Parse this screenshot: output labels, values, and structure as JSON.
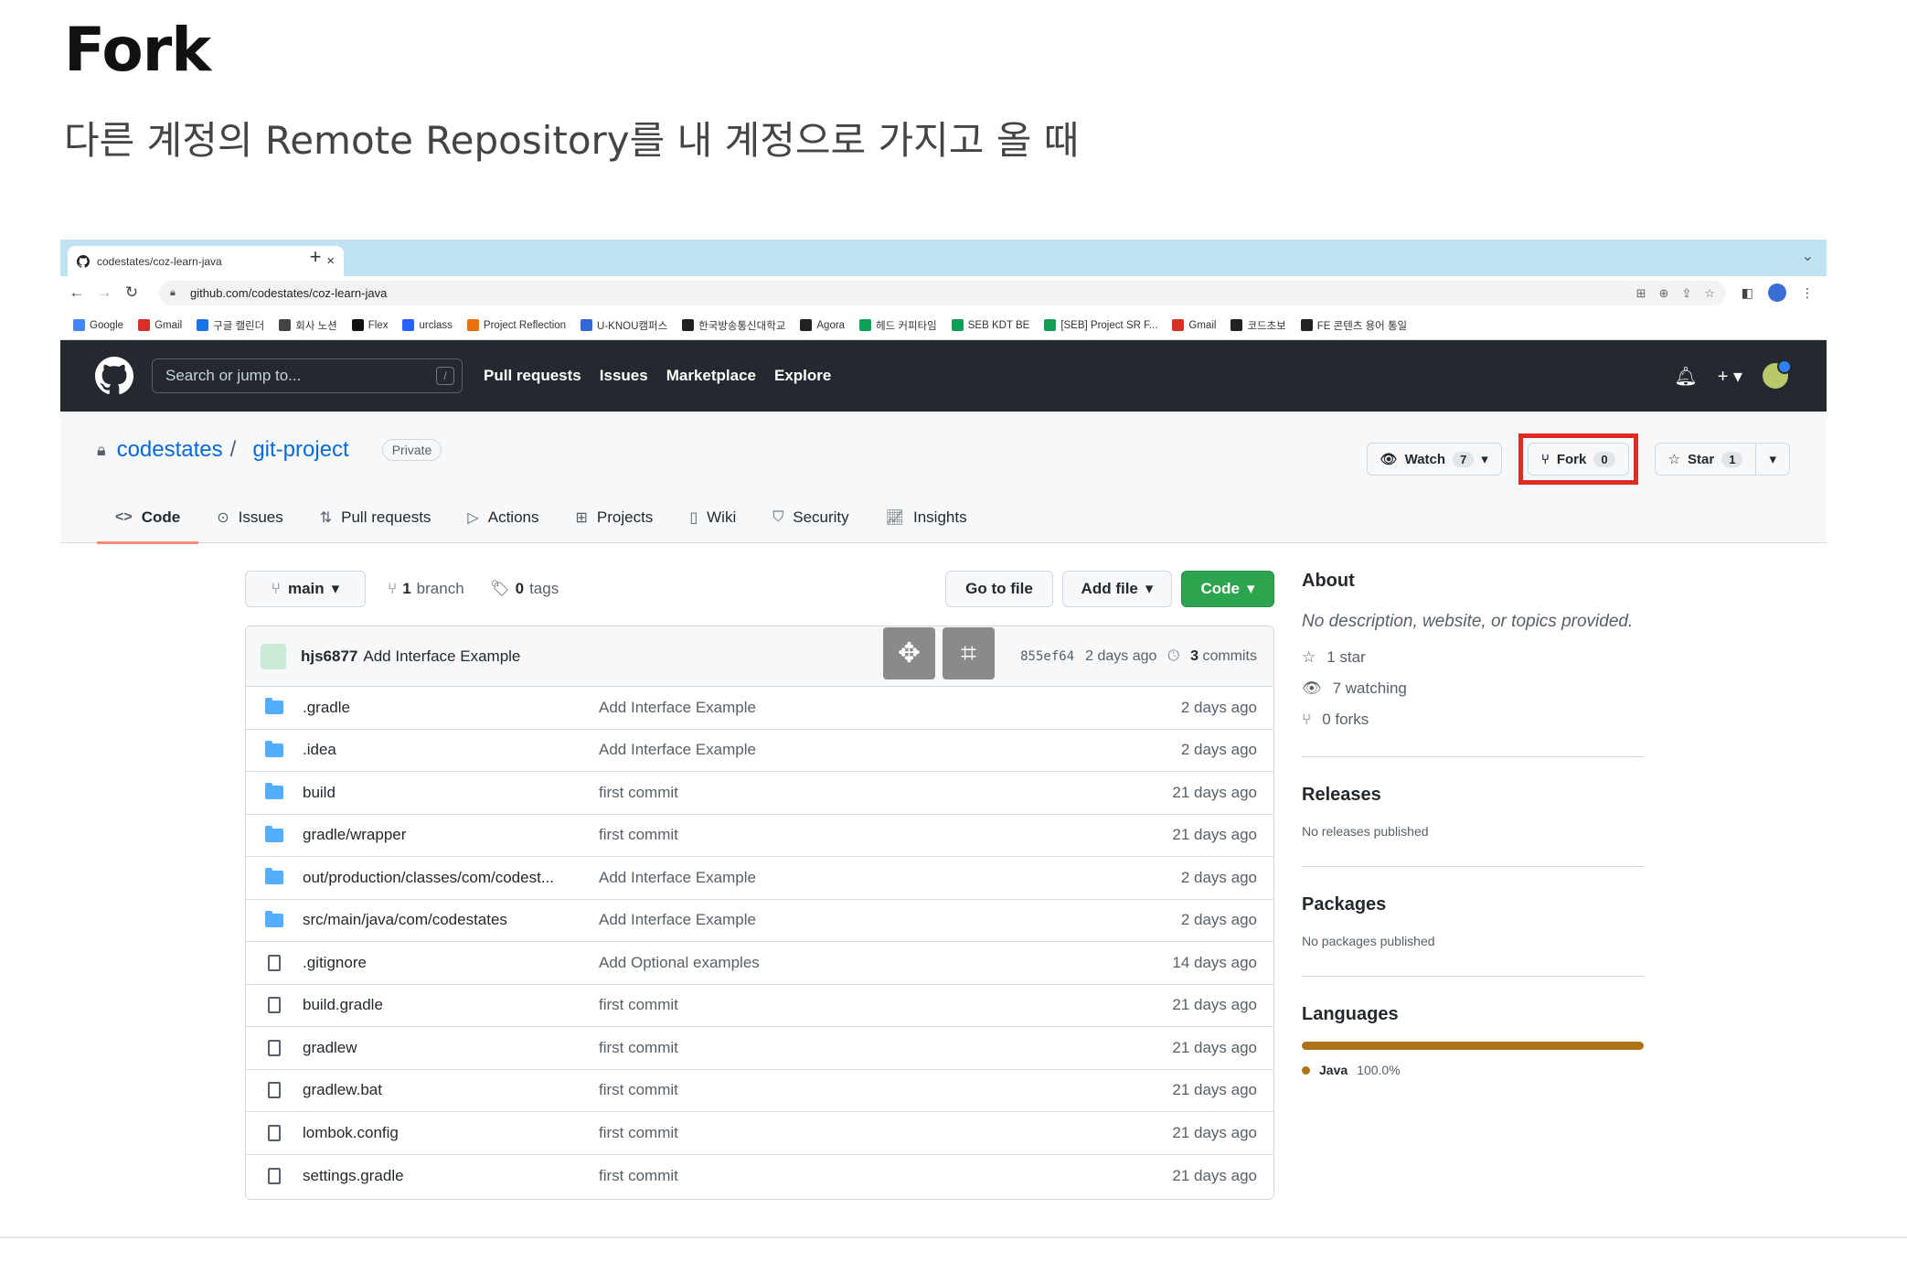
{
  "slide": {
    "title": "Fork",
    "subtitle": "다른 계정의 Remote Repository를 내 계정으로 가지고 올 때"
  },
  "browser": {
    "tab_title": "codestates/coz-learn-java",
    "url": "github.com/codestates/coz-learn-java",
    "bookmarks": [
      "Google",
      "Gmail",
      "구글 캘린더",
      "회사 노션",
      "Flex",
      "urclass",
      "Project Reflection",
      "U-KNOU캠퍼스",
      "한국방송통신대학교",
      "Agora",
      "헤드 커피타임",
      "SEB KDT BE",
      "[SEB] Project SR F...",
      "Gmail",
      "코드초보",
      "FE 콘텐츠 용어 통일"
    ]
  },
  "gh_header": {
    "search_placeholder": "Search or jump to...",
    "search_shortcut": "/",
    "nav": [
      "Pull requests",
      "Issues",
      "Marketplace",
      "Explore"
    ]
  },
  "repo": {
    "owner": "codestates",
    "name": "git-project",
    "visibility": "Private",
    "watch_label": "Watch",
    "watch_count": "7",
    "fork_label": "Fork",
    "fork_count": "0",
    "star_label": "Star",
    "star_count": "1",
    "tabs": [
      "Code",
      "Issues",
      "Pull requests",
      "Actions",
      "Projects",
      "Wiki",
      "Security",
      "Insights"
    ]
  },
  "toolbar": {
    "branch": "main",
    "branch_count": "1",
    "branch_word": "branch",
    "tag_count": "0",
    "tag_word": "tags",
    "go_to_file": "Go to file",
    "add_file": "Add file",
    "code": "Code"
  },
  "commit": {
    "author": "hjs6877",
    "message": "Add Interface Example",
    "sha": "855ef64",
    "time": "2 days ago",
    "commit_count": "3",
    "commit_word": "commits"
  },
  "files": [
    {
      "type": "dir",
      "name": ".gradle",
      "message": "Add Interface Example",
      "time": "2 days ago"
    },
    {
      "type": "dir",
      "name": ".idea",
      "message": "Add Interface Example",
      "time": "2 days ago"
    },
    {
      "type": "dir",
      "name": "build",
      "message": "first commit",
      "time": "21 days ago"
    },
    {
      "type": "dir",
      "name": "gradle/wrapper",
      "message": "first commit",
      "time": "21 days ago"
    },
    {
      "type": "dir",
      "name": "out/production/classes/com/codest...",
      "message": "Add Interface Example",
      "time": "2 days ago"
    },
    {
      "type": "dir",
      "name": "src/main/java/com/codestates",
      "message": "Add Interface Example",
      "time": "2 days ago"
    },
    {
      "type": "file",
      "name": ".gitignore",
      "message": "Add Optional examples",
      "time": "14 days ago"
    },
    {
      "type": "file",
      "name": "build.gradle",
      "message": "first commit",
      "time": "21 days ago"
    },
    {
      "type": "file",
      "name": "gradlew",
      "message": "first commit",
      "time": "21 days ago"
    },
    {
      "type": "file",
      "name": "gradlew.bat",
      "message": "first commit",
      "time": "21 days ago"
    },
    {
      "type": "file",
      "name": "lombok.config",
      "message": "first commit",
      "time": "21 days ago"
    },
    {
      "type": "file",
      "name": "settings.gradle",
      "message": "first commit",
      "time": "21 days ago"
    }
  ],
  "sidebar": {
    "about_title": "About",
    "about_desc": "No description, website, or topics provided.",
    "stars": "1 star",
    "watching": "7 watching",
    "forks": "0 forks",
    "releases_title": "Releases",
    "releases_text": "No releases published",
    "packages_title": "Packages",
    "packages_text": "No packages published",
    "languages_title": "Languages",
    "language_name": "Java",
    "language_pct": "100.0%"
  },
  "colors": {
    "fork_highlight": "#e02b20",
    "java": "#b07219",
    "code_button": "#2da44e",
    "header": "#24292f"
  }
}
